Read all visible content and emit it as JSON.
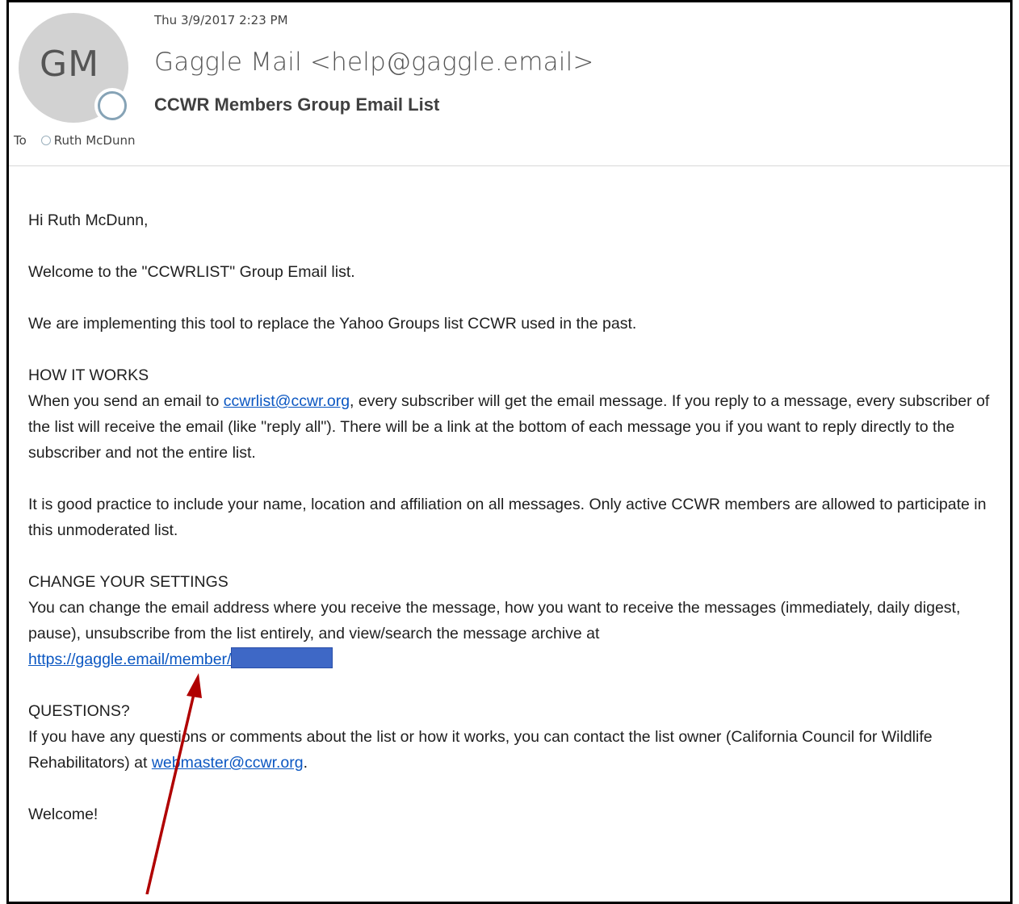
{
  "message": {
    "datetime": "Thu 3/9/2017 2:23 PM",
    "avatar_initials": "GM",
    "from": "Gaggle Mail <help@gaggle.email>",
    "subject": "CCWR Members Group Email List",
    "to_label": "To",
    "recipient": "Ruth McDunn"
  },
  "body": {
    "greeting": "Hi Ruth McDunn,",
    "welcome_line": "Welcome to the \"CCWRLIST\" Group Email list.",
    "intro": "We are implementing this tool to replace the Yahoo Groups list CCWR used in the past.",
    "how_heading": "HOW IT WORKS",
    "how_text_before": "When you send an email to ",
    "how_link": "ccwrlist@ccwr.org",
    "how_text_after": ", every subscriber will get the email message. If you reply to a message, every subscriber of the list will receive the email (like \"reply all\"). There will be a link at the bottom of each message you if you want to reply directly to the subscriber and not the entire list.",
    "practice": "It is good practice to include your name, location and affiliation on all messages. Only active CCWR members are allowed to participate in this unmoderated list.",
    "settings_heading": "CHANGE YOUR SETTINGS",
    "settings_text": "You can change the email address where you receive the message, how you want to receive the messages (immediately, daily digest, pause), unsubscribe from the list entirely, and view/search the message archive at",
    "settings_link": "https://gaggle.email/member/",
    "questions_heading": "QUESTIONS?",
    "questions_text_before": "If you have any questions or comments about the list or how it works, you can contact the list owner (California Council for Wildlife Rehabilitators) at ",
    "questions_link": "webmaster@ccwr.org",
    "questions_text_after": ".",
    "closing": "Welcome!"
  },
  "colors": {
    "link": "#0b57c2",
    "redaction": "#3e68c6",
    "annotation_arrow": "#b00000",
    "avatar_bg": "#d2d2d2"
  },
  "icons": {
    "presence": "presence-status-icon",
    "annotation": "arrow-annotation-icon"
  }
}
